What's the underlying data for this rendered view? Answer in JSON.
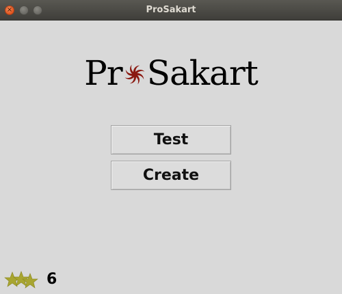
{
  "window": {
    "title": "ProSakart",
    "close_glyph": "×",
    "min_glyph": "–",
    "max_glyph": "□"
  },
  "logo": {
    "text_before": "Pr",
    "text_after": "Sakart",
    "emblem_icon": "red-spiral-icon",
    "emblem_color": "#8b1a12"
  },
  "buttons": {
    "test_label": "Test",
    "create_label": "Create"
  },
  "footer": {
    "stars_icon": "stars-icon",
    "star_color": "#a8a530",
    "count": "6"
  }
}
